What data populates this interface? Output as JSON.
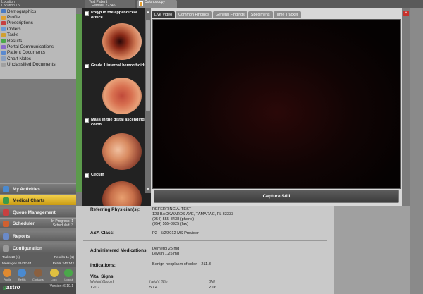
{
  "topbar": {
    "location_label": "Location",
    "location_value": "Location 15",
    "patient_tab": "Test Patient",
    "patient_tab_sub": "...Female, 72345",
    "procedure_tab": "Colonoscopy"
  },
  "chart_nav": [
    {
      "label": "Demographics",
      "color": "#4a7bc4"
    },
    {
      "label": "Profile",
      "color": "#e0a030"
    },
    {
      "label": "Prescriptions",
      "color": "#c84040"
    },
    {
      "label": "Orders",
      "color": "#6a9ad8"
    },
    {
      "label": "Tasks",
      "color": "#d0a030"
    },
    {
      "label": "Results",
      "color": "#4aa84a"
    },
    {
      "label": "Portal Communications",
      "color": "#8a6ac8"
    },
    {
      "label": "Patient Documents",
      "color": "#5a8ad0"
    },
    {
      "label": "Chart Notes",
      "color": "#8aa0c0"
    },
    {
      "label": "Unclassified Documents",
      "color": "#a0a0a0"
    }
  ],
  "main_nav": {
    "my_activities": "My Activities",
    "medical_charts": "Medical Charts",
    "queue_management": "Queue Management",
    "scheduler": "Scheduler",
    "scheduler_in_progress": "In Progress: 1",
    "scheduler_scheduled": "Scheduled: 3",
    "reports": "Reports",
    "configuration": "Configuration"
  },
  "stats": {
    "tasks_label": "Tasks",
    "tasks_value": "10 (1)",
    "results_label": "Results",
    "results_value": "11 (1)",
    "messages_label": "Messages",
    "messages_value": "3843/344",
    "refills_label": "Refills",
    "refills_value": "242/142"
  },
  "bottom_icons": [
    {
      "label": "Profile",
      "color": "#e08a30"
    },
    {
      "label": "Refills",
      "color": "#4a8ad0"
    },
    {
      "label": "Contacts",
      "color": "#8a6040"
    },
    {
      "label": "Lock",
      "color": "#e0c040"
    },
    {
      "label": "Logout",
      "color": "#4aa84a"
    }
  ],
  "brand": {
    "logo_prefix": "g",
    "logo_text": "astro",
    "version": "Version: 6.10.1"
  },
  "images": [
    {
      "title": "Polyp in the appendiceal orifice"
    },
    {
      "title": "Grade 1 internal hemorrhoids"
    },
    {
      "title": "Mass in the distal ascending colon"
    },
    {
      "title": "Cecum"
    }
  ],
  "tabs": [
    "Live Video",
    "Common Findings",
    "General Findings",
    "Specimens",
    "Time Tracker"
  ],
  "capture_label": "Capture Still",
  "report": {
    "referring_label": "Referring Physician(s):",
    "referring_name": "REFERRING A. TEST",
    "referring_address": "123 BACKWARDS AVE, TAMARAC, FL 33333",
    "referring_phone": "(954) 555-8438 (phone)",
    "referring_fax": "(954) 555-8925 (fax)",
    "asa_label": "ASA Class:",
    "asa_value": "P2 - 5/2/2012 MS Provider",
    "meds_label": "Administered Medications:",
    "meds_1": "Demerol 25 mg",
    "meds_2": "Levsin 1.25 mg",
    "indications_label": "Indications:",
    "indications_value": "Benign neoplasm of colon - 211.3",
    "vitals_label": "Vital Signs:",
    "vitals_headers": [
      "Weight (lbs/oz)",
      "Height (ft/in)",
      "BMI"
    ],
    "vitals_values": [
      "120 /",
      "5 / 4",
      "20.6"
    ]
  }
}
